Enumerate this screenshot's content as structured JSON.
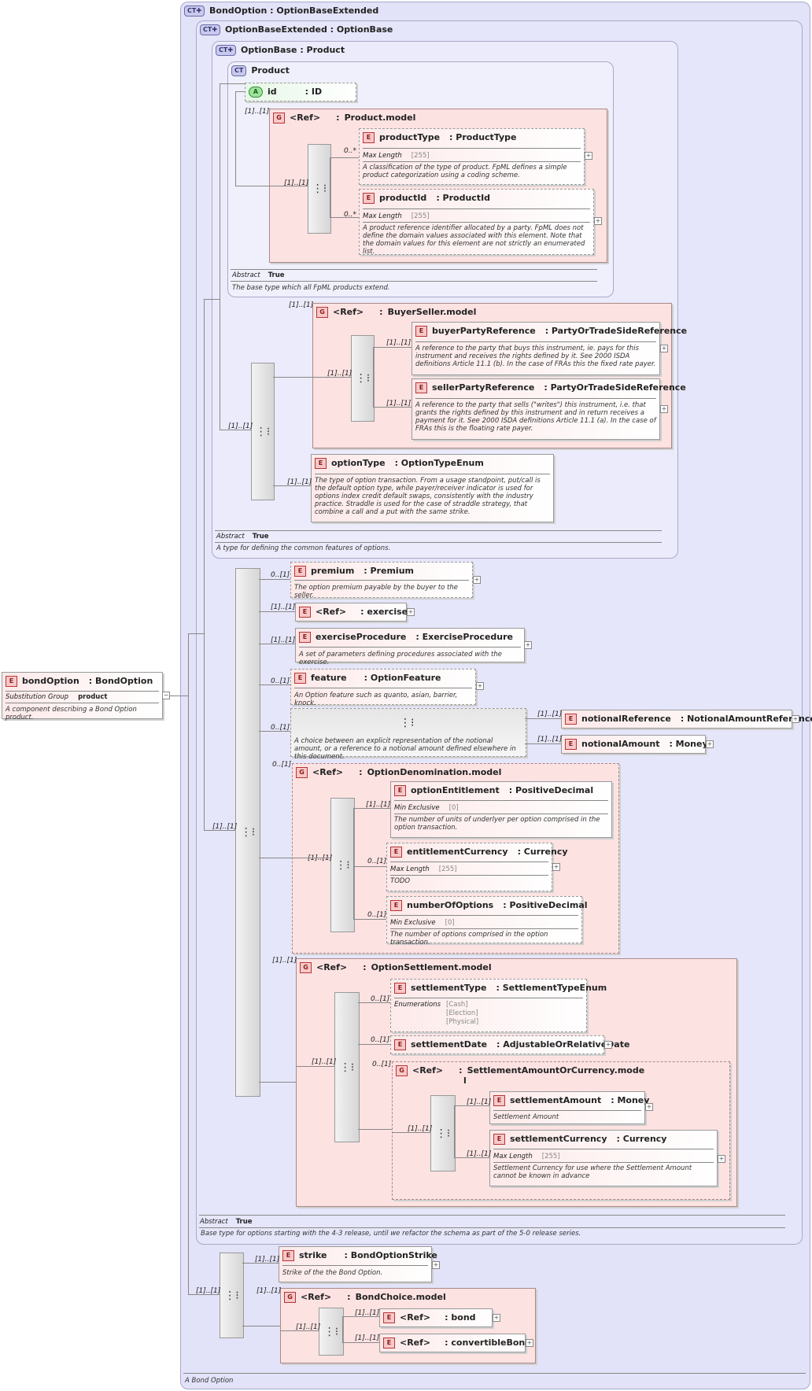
{
  "root": {
    "title": "BondOption : OptionBaseExtended",
    "desc": "A Bond Option"
  },
  "obe": {
    "title": "OptionBaseExtended : OptionBase",
    "abstract_label": "Abstract",
    "abstract_val": "True",
    "desc": "Base type for options starting with the 4-3 release, until we refactor the schema as part of the 5-0 release series."
  },
  "ob": {
    "title": "OptionBase : Product",
    "abstract_label": "Abstract",
    "abstract_val": "True",
    "desc": "A type for defining the common features of options."
  },
  "product": {
    "title": "Product",
    "abstract_label": "Abstract",
    "abstract_val": "True",
    "desc": "The base type which all FpML products extend.",
    "id_attr": "id",
    "id_type": ": ID",
    "model": "Product.model",
    "productType": {
      "name": "productType",
      "type": ": ProductType",
      "facet": "Max Length",
      "facet_val": "[255]",
      "desc": "A classification of the type of product. FpML defines a simple product categorization using a coding scheme.",
      "card": "0..*"
    },
    "productId": {
      "name": "productId",
      "type": ": ProductId",
      "facet": "Max Length",
      "facet_val": "[255]",
      "desc": "A product reference identifier allocated by a party. FpML does not define the domain values associated with this element. Note that the domain values for this element are not strictly an enumerated list.",
      "card": "0..*"
    }
  },
  "ref": "<Ref>",
  "buyerSeller": {
    "model": "BuyerSeller.model",
    "buyer": {
      "name": "buyerPartyReference",
      "type": ": PartyOrTradeSideReference",
      "desc": "A reference to the party that buys this instrument, ie. pays for this instrument and receives the rights defined by it. See 2000 ISDA definitions Article 11.1 (b). In the case of FRAs this the fixed rate payer."
    },
    "seller": {
      "name": "sellerPartyReference",
      "type": ": PartyOrTradeSideReference",
      "desc": "A reference to the party that sells (\"writes\") this instrument, i.e. that grants the rights defined by this instrument and in return receives a payment for it. See 2000 ISDA definitions Article 11.1 (a). In the case of FRAs this is the floating rate payer."
    }
  },
  "optionType": {
    "name": "optionType",
    "type": ": OptionTypeEnum",
    "desc": "The type of option transaction. From a usage standpoint, put/call is the default option type, while payer/receiver indicator is used for options index credit default swaps, consistently with the industry practice. Straddle is used for the case of straddle strategy, that combine a call and a put with the same strike."
  },
  "premium": {
    "name": "premium",
    "type": ": Premium",
    "desc": "The option premium payable by the buyer to the seller."
  },
  "exercise": {
    "name": "exercise",
    "type": ": exercise"
  },
  "exerciseProcedure": {
    "name": "exerciseProcedure",
    "type": ": ExerciseProcedure",
    "desc": "A set of parameters defining procedures associated with the exercise."
  },
  "feature": {
    "name": "feature",
    "type": ": OptionFeature",
    "desc": "An Option feature such as quanto, asian, barrier, knock."
  },
  "notionalChoice": {
    "desc": "A choice between an explicit representation of the notional amount, or a reference to a notional amount defined elsewhere in this document.",
    "ref": {
      "name": "notionalReference",
      "type": ": NotionalAmountReference"
    },
    "amt": {
      "name": "notionalAmount",
      "type": ": Money"
    }
  },
  "denom": {
    "model": "OptionDenomination.model",
    "entitlement": {
      "name": "optionEntitlement",
      "type": ": PositiveDecimal",
      "facet": "Min Exclusive",
      "facet_val": "[0]",
      "desc": "The number of units of underlyer per option comprised in the option transaction."
    },
    "entCcy": {
      "name": "entitlementCurrency",
      "type": ": Currency",
      "facet": "Max Length",
      "facet_val": "[255]",
      "desc": "TODO"
    },
    "numOpt": {
      "name": "numberOfOptions",
      "type": ": PositiveDecimal",
      "facet": "Min Exclusive",
      "facet_val": "[0]",
      "desc": "The number of options comprised in the option transaction."
    }
  },
  "settle": {
    "model": "OptionSettlement.model",
    "type": {
      "name": "settlementType",
      "type": ": SettlementTypeEnum",
      "facet": "Enumerations",
      "vals": [
        "[Cash]",
        "[Election]",
        "[Physical]"
      ]
    },
    "date": {
      "name": "settlementDate",
      "type": ": AdjustableOrRelativeDate"
    },
    "amtCcy": {
      "model": "SettlementAmountOrCurrency.mode",
      "model2": "l",
      "amt": {
        "name": "settlementAmount",
        "type": ": Money",
        "desc": "Settlement Amount"
      },
      "ccy": {
        "name": "settlementCurrency",
        "type": ": Currency",
        "facet": "Max Length",
        "facet_val": "[255]",
        "desc": "Settlement Currency for use where the Settlement Amount cannot be known in advance"
      }
    }
  },
  "strike": {
    "name": "strike",
    "type": ": BondOptionStrike",
    "desc": "Strike of the the Bond Option."
  },
  "bondChoice": {
    "model": "BondChoice.model",
    "bond": ": bond",
    "cbond": ": convertibleBond"
  },
  "bondOption": {
    "name": "bondOption",
    "type": ": BondOption",
    "sub_label": "Substitution Group",
    "sub_val": "product",
    "desc": "A component describing a Bond Option product."
  },
  "cards": {
    "c11": "[1]..[1]",
    "c01": "0..[1]",
    "c0s": "0..*"
  }
}
